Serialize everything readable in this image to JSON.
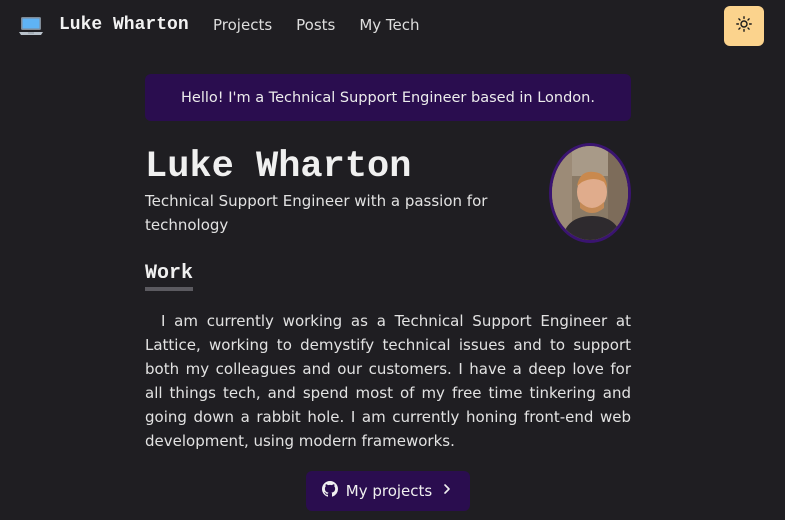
{
  "navbar": {
    "logo_icon": "laptop-icon",
    "brand": "Luke Wharton",
    "links": [
      {
        "label": "Projects"
      },
      {
        "label": "Posts"
      },
      {
        "label": "My Tech"
      }
    ],
    "theme_toggle_icon": "sun-icon",
    "theme_toggle_color": "#fbd38d"
  },
  "greeting": "Hello! I'm a Technical Support Engineer based in London.",
  "hero": {
    "name": "Luke Wharton",
    "tagline": "Technical Support Engineer with a passion for technology",
    "avatar_icon": "profile-photo"
  },
  "work": {
    "title": "Work",
    "body": "I am currently working as a Technical Support Engineer at Lattice, working to demystify technical issues and to support both my colleagues and our customers. I have a deep love for all things tech, and spend most of my free time tinkering and going down a rabbit hole. I am currently honing front-end web development, using modern frameworks."
  },
  "cta": {
    "icon": "github-icon",
    "label": "My projects",
    "chevron_icon": "chevron-right-icon"
  },
  "colors": {
    "background": "#1f1e22",
    "accent": "#2a0d4f"
  }
}
